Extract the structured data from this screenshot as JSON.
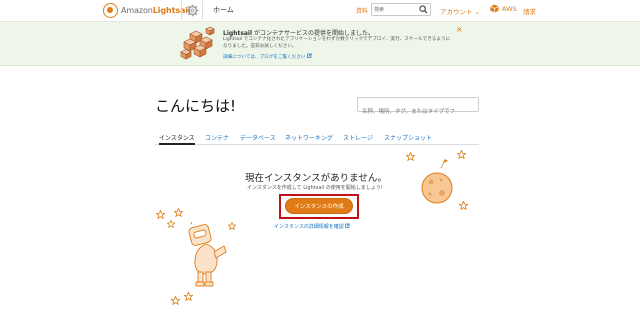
{
  "header": {
    "logo_prefix": "Amazon",
    "logo_brand": "Lightsail",
    "home": "ホーム",
    "resources": "資料",
    "search_placeholder": "検索",
    "account": "アカウント ⌄",
    "aws": "AWS",
    "billing": "請求"
  },
  "banner": {
    "title_brand": "Lightsail",
    "title_rest": " がコンテナサービスの提供を開始しました。",
    "body": "Lightsail でコンテナ化されたアプリケーションをわずか数クリックでデプロイ、実行、スケールできるようになりました。是非お試しください。",
    "link": "詳細については、ブログをご覧ください",
    "close": "×"
  },
  "main": {
    "greeting": "こんにちは!",
    "search_placeholder": "名称、場所、タグ、またはタイプでフ",
    "tabs": [
      "インスタンス",
      "コンテナ",
      "データベース",
      "ネットワーキング",
      "ストレージ",
      "スナップショット"
    ],
    "empty_title": "現在インスタンスがありません。",
    "empty_sub": "インスタンスを作成して Lightsail の使用を開始しましょう!",
    "create_button": "インスタンスの作成",
    "details_link": "インスタンスの詳細情報を確認"
  },
  "colors": {
    "accent": "#e07b16",
    "link": "#1a74c2",
    "banner_bg": "#eef6ea",
    "highlight": "#c0101a"
  },
  "icons": [
    "lightsail-logo-icon",
    "gear-icon",
    "search-icon",
    "aws-box-icon",
    "container-cubes-icon",
    "close-icon",
    "external-link-icon",
    "robot-icon",
    "planet-icon",
    "star-icon"
  ]
}
